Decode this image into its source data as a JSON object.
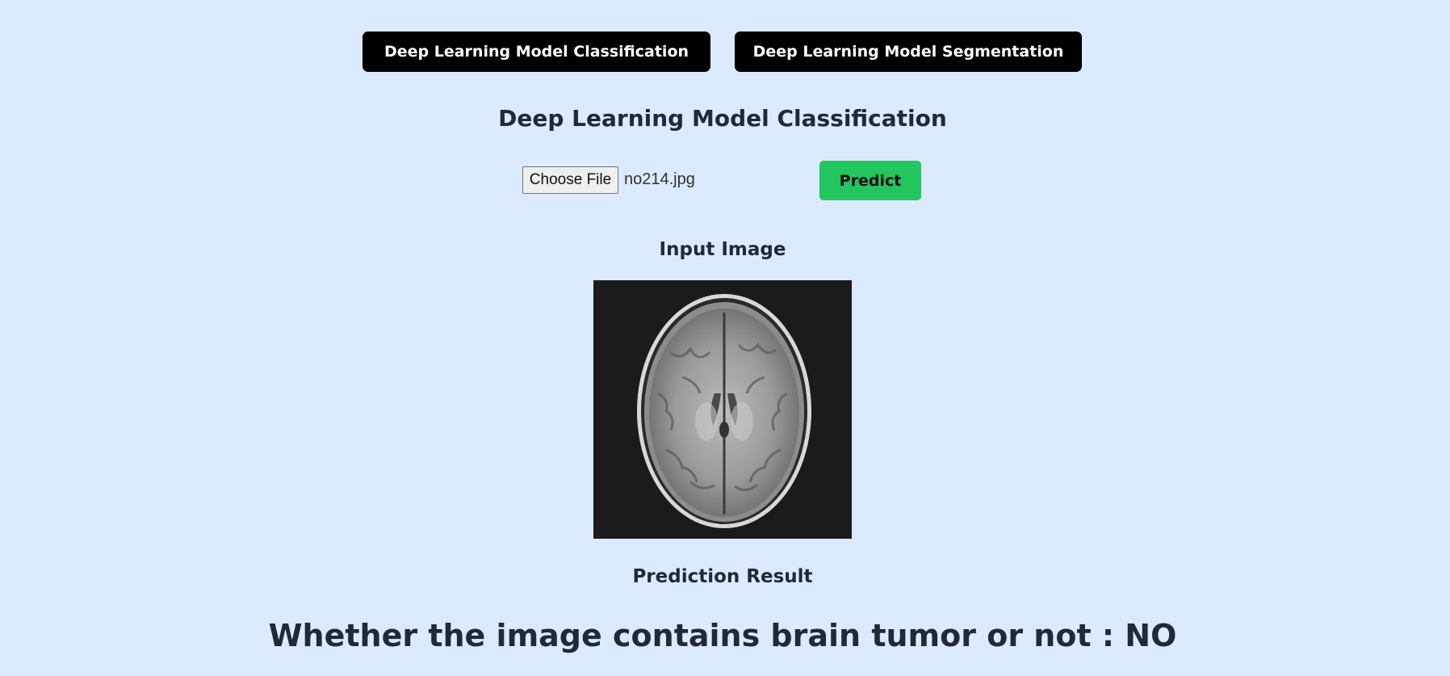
{
  "nav": {
    "classification_label": "Deep Learning Model Classification",
    "segmentation_label": "Deep Learning Model Segmentation"
  },
  "section": {
    "title": "Deep Learning Model Classification"
  },
  "upload": {
    "choose_file_label": "Choose File",
    "file_name": "no214.jpg",
    "predict_label": "Predict"
  },
  "input_image": {
    "label": "Input Image"
  },
  "prediction": {
    "label": "Prediction Result",
    "text": "Whether the image contains brain tumor or not : NO"
  },
  "colors": {
    "background": "#dbeafe",
    "nav_button": "#000000",
    "predict_button": "#22c55e",
    "text": "#1f2937"
  }
}
